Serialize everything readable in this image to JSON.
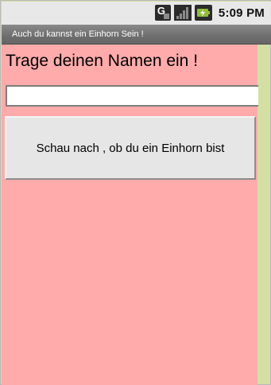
{
  "status_bar": {
    "time": "5:09 PM",
    "icons": [
      "g-notification-icon",
      "signal-icon",
      "battery-icon"
    ]
  },
  "app": {
    "title": "Auch du kannst ein Einhorn Sein !"
  },
  "main": {
    "prompt": "Trage deinen Namen ein !",
    "name_input": {
      "value": "",
      "placeholder": ""
    },
    "check_button_label": "Schau nach , ob du ein Einhorn bist"
  },
  "colors": {
    "content_background": "#ffabab",
    "side_background": "#d4dfa4",
    "title_bar": "#6e6e6e",
    "status_bar": "#e8e8e8"
  }
}
